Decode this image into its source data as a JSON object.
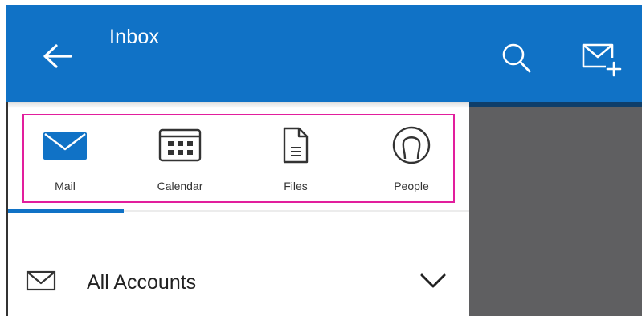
{
  "header": {
    "title": "Inbox",
    "back_icon": "arrow-left-icon",
    "search_icon": "search-icon",
    "compose_icon": "new-mail-icon",
    "background_color": "#1072c6"
  },
  "tabs": [
    {
      "label": "Mail",
      "icon": "mail-icon",
      "selected": true
    },
    {
      "label": "Calendar",
      "icon": "calendar-icon",
      "selected": false
    },
    {
      "label": "Files",
      "icon": "file-icon",
      "selected": false
    },
    {
      "label": "People",
      "icon": "people-icon",
      "selected": false
    }
  ],
  "highlight_color": "#e21e9d",
  "accounts": {
    "label": "All Accounts",
    "icon": "envelope-icon",
    "expand_icon": "chevron-down-icon"
  }
}
